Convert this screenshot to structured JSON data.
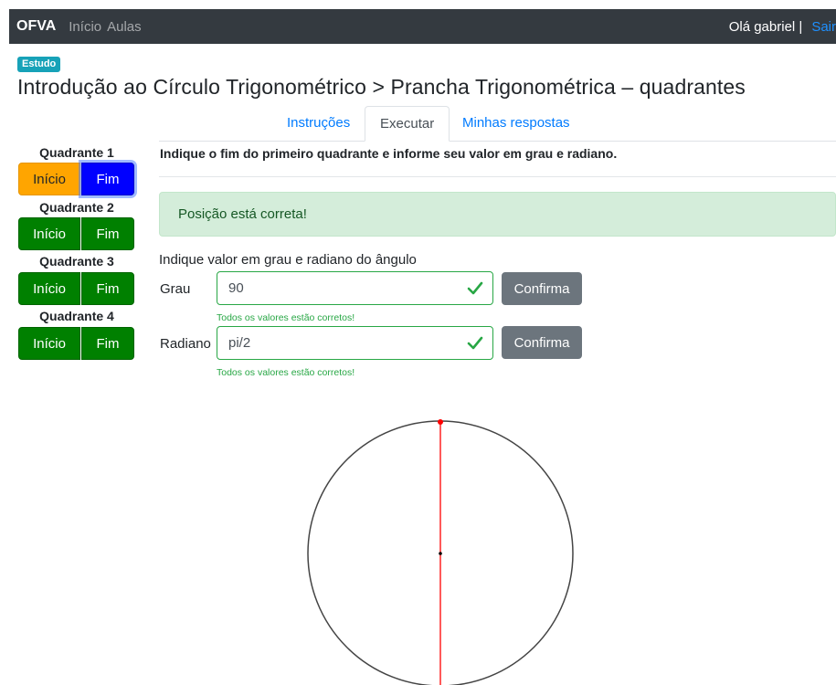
{
  "navbar": {
    "brand": "OFVA",
    "links": [
      "Início",
      "Aulas"
    ],
    "greeting": "Olá gabriel |",
    "logout": "Sair"
  },
  "header": {
    "badge": "Estudo",
    "title": "Introdução ao Círculo Trigonométrico > Prancha Trigonométrica – quadrantes"
  },
  "tabs": [
    {
      "label": "Instruções",
      "active": false
    },
    {
      "label": "Executar",
      "active": true
    },
    {
      "label": "Minhas respostas",
      "active": false
    }
  ],
  "sidebar": {
    "quadrants": [
      {
        "title": "Quadrante 1",
        "start": "Início",
        "end": "Fim"
      },
      {
        "title": "Quadrante 2",
        "start": "Início",
        "end": "Fim"
      },
      {
        "title": "Quadrante 3",
        "start": "Início",
        "end": "Fim"
      },
      {
        "title": "Quadrante 4",
        "start": "Início",
        "end": "Fim"
      }
    ]
  },
  "main": {
    "instruction": "Indique o fim do primeiro quadrante e informe seu valor em grau e radiano.",
    "alert": "Posição está correta!",
    "prompt": "Indique valor em grau e radiano do ângulo",
    "grau": {
      "label": "Grau",
      "value": "90",
      "confirm": "Confirma",
      "feedback": "Todos os valores estão corretos!"
    },
    "radiano": {
      "label": "Radiano",
      "value": "pi/2",
      "confirm": "Confirma",
      "feedback": "Todos os valores estão corretos!"
    }
  },
  "colors": {
    "navbar": "#343a40",
    "quadrant_green": "#008000",
    "start_active_orange": "#ffa500",
    "end_active_blue": "#0000ff",
    "success_bg": "#d4edda",
    "valid_green": "#28a745",
    "angle_line": "#ff0000"
  }
}
